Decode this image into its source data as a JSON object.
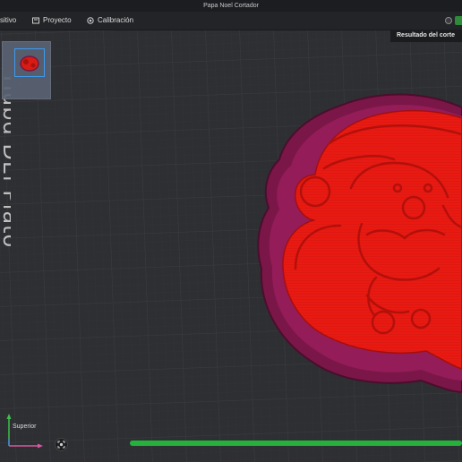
{
  "window": {
    "title": "Papa Noel Cortador"
  },
  "menu": {
    "items": [
      {
        "label": "sitivo"
      },
      {
        "label": "Proyecto"
      },
      {
        "label": "Calibración"
      }
    ]
  },
  "panel": {
    "slice_result_label": "Resultado del corte"
  },
  "viewport": {
    "plate_label": "Hubd DEl Plato",
    "axis_view_label": "Superior"
  },
  "progress": {
    "value": 1.0
  },
  "colors": {
    "background": "#2e2f33",
    "model_red": "#e81a12",
    "model_outline": "#8a1a50",
    "progress_green": "#26b13c",
    "minimap_frame": "#3fa3ff"
  }
}
